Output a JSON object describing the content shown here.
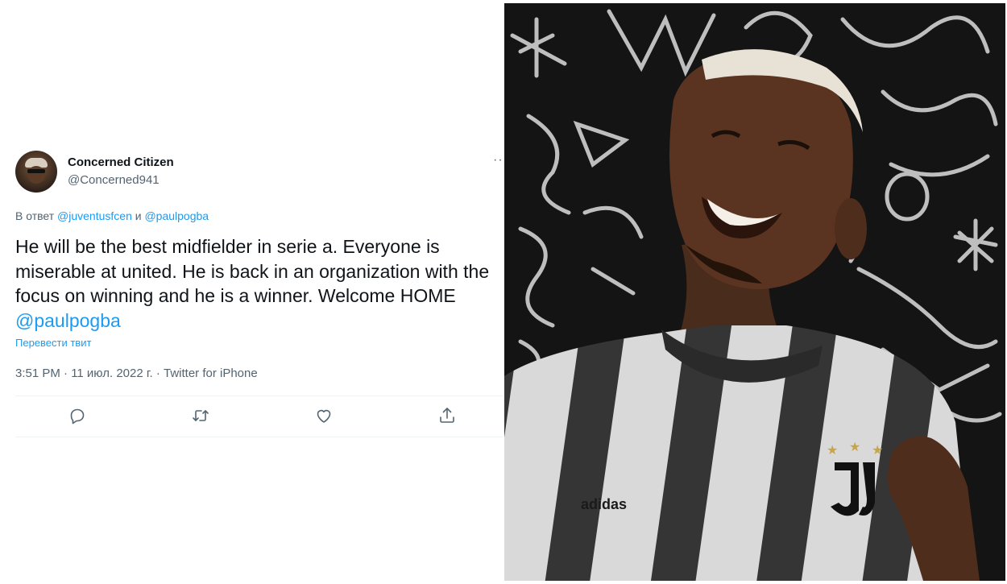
{
  "tweet": {
    "author_name": "Concerned Citizen",
    "author_handle": "@Concerned941",
    "more_label": "··",
    "reply_prefix": "В ответ",
    "reply_user_1": "@juventusfcen",
    "reply_joiner": "и",
    "reply_user_2": "@paulpogba",
    "body_text": "He will be the best midfielder in serie a. Everyone is miserable at united. He is back in an organization with the focus on winning and he is a winner. Welcome HOME",
    "body_mention": "@paulpogba",
    "translate_label": "Перевести твит",
    "meta": "3:51 PM · 11 июл. 2022 г. · Twitter for iPhone",
    "actions": [
      {
        "name": "reply",
        "icon": "comment-icon"
      },
      {
        "name": "retweet",
        "icon": "retweet-icon"
      },
      {
        "name": "like",
        "icon": "heart-icon"
      },
      {
        "name": "share",
        "icon": "share-icon"
      }
    ]
  },
  "photo": {
    "subject": "player-photo",
    "shirt_brand": "adidas"
  },
  "colors": {
    "link": "#1d9bf0",
    "secondary_text": "#536471",
    "primary_text": "#0f1419",
    "photo_background": "#141414"
  }
}
